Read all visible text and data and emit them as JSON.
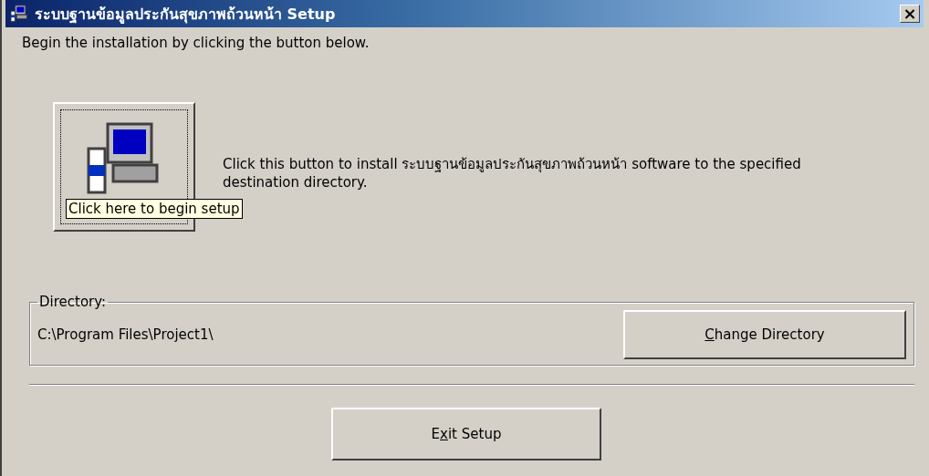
{
  "window": {
    "title": "ระบบฐานข้อมูลประกันสุขภาพถ้วนหน้า Setup",
    "close": "×"
  },
  "intro": "Begin the installation by clicking the button below.",
  "install": {
    "description": "Click this button to install ระบบฐานข้อมูลประกันสุขภาพถ้วนหน้า software to the specified destination directory.",
    "tooltip": "Click here to begin setup"
  },
  "directory": {
    "legend": "Directory:",
    "path": "C:\\Program Files\\Project1\\",
    "button": {
      "label": {
        "key": "C",
        "after": "hange Directory"
      }
    }
  },
  "exit_button": {
    "label": {
      "before": "E",
      "key": "x",
      "after": "it Setup"
    }
  }
}
